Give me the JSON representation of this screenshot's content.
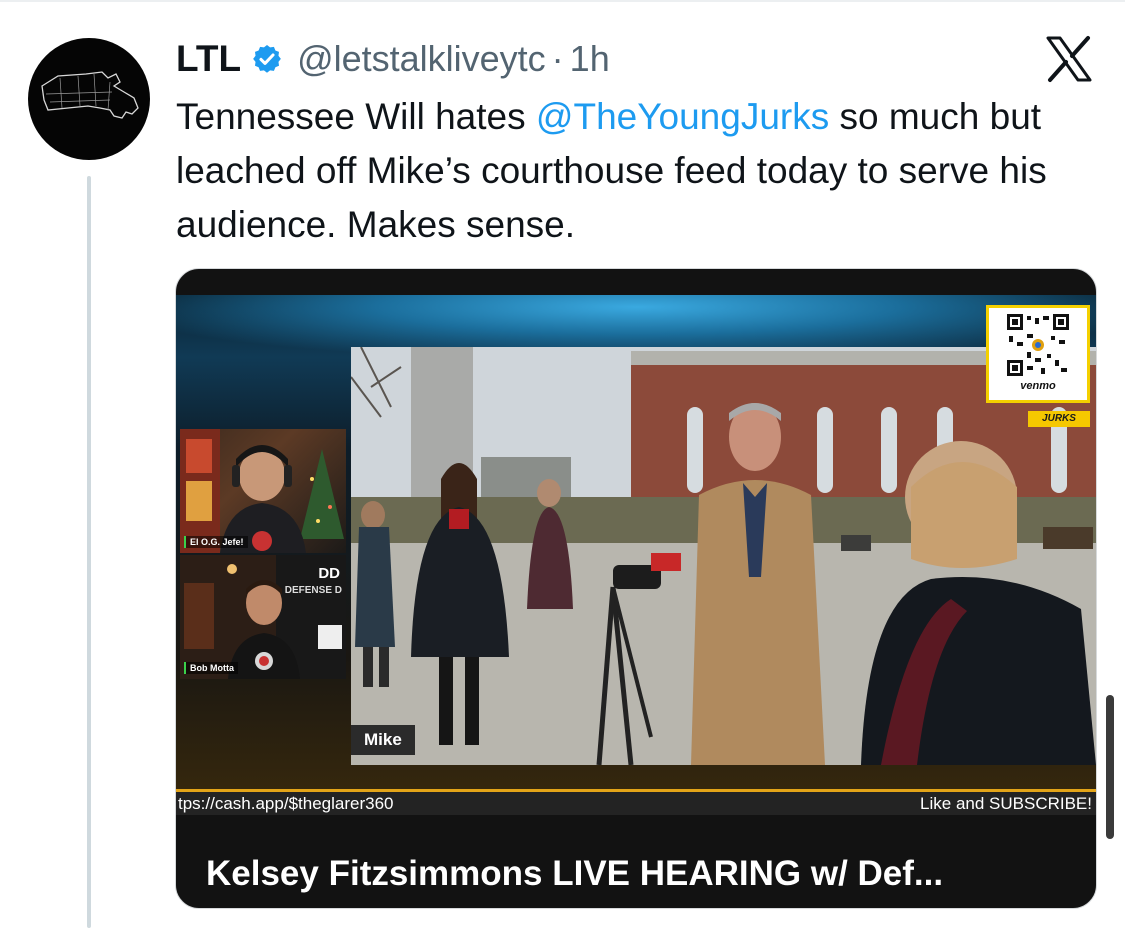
{
  "tweet": {
    "display_name": "LTL",
    "handle": "@letstalkliveytc",
    "separator": "·",
    "time": "1h",
    "text_before": "Tennessee Will hates ",
    "mention": "@TheYoungJurks",
    "text_after": " so much but leached off Mike’s courthouse feed today to serve his audience. Makes sense."
  },
  "media": {
    "panel1_label": "El O.G. Jefe!",
    "panel2_label": "Bob Motta",
    "panel2_brand": "DD",
    "panel2_brand_sub": "DEFENSE D",
    "main_name_tag": "Mike",
    "qr_label": "venmo",
    "jurks_text": "JURKS",
    "ticker_left": "tps://cash.app/$theglarer360",
    "ticker_right": "Like and SUBSCRIBE!",
    "video_title": "Kelsey Fitzsimmons LIVE HEARING w/ Def..."
  },
  "icons": {
    "verified": "verified-badge-icon",
    "x_logo": "x-logo-icon",
    "avatar": "massachusetts-map-icon"
  },
  "colors": {
    "mention": "#1d9bf0",
    "verified": "#1d9bf0",
    "ticker_accent": "#e3a418"
  }
}
